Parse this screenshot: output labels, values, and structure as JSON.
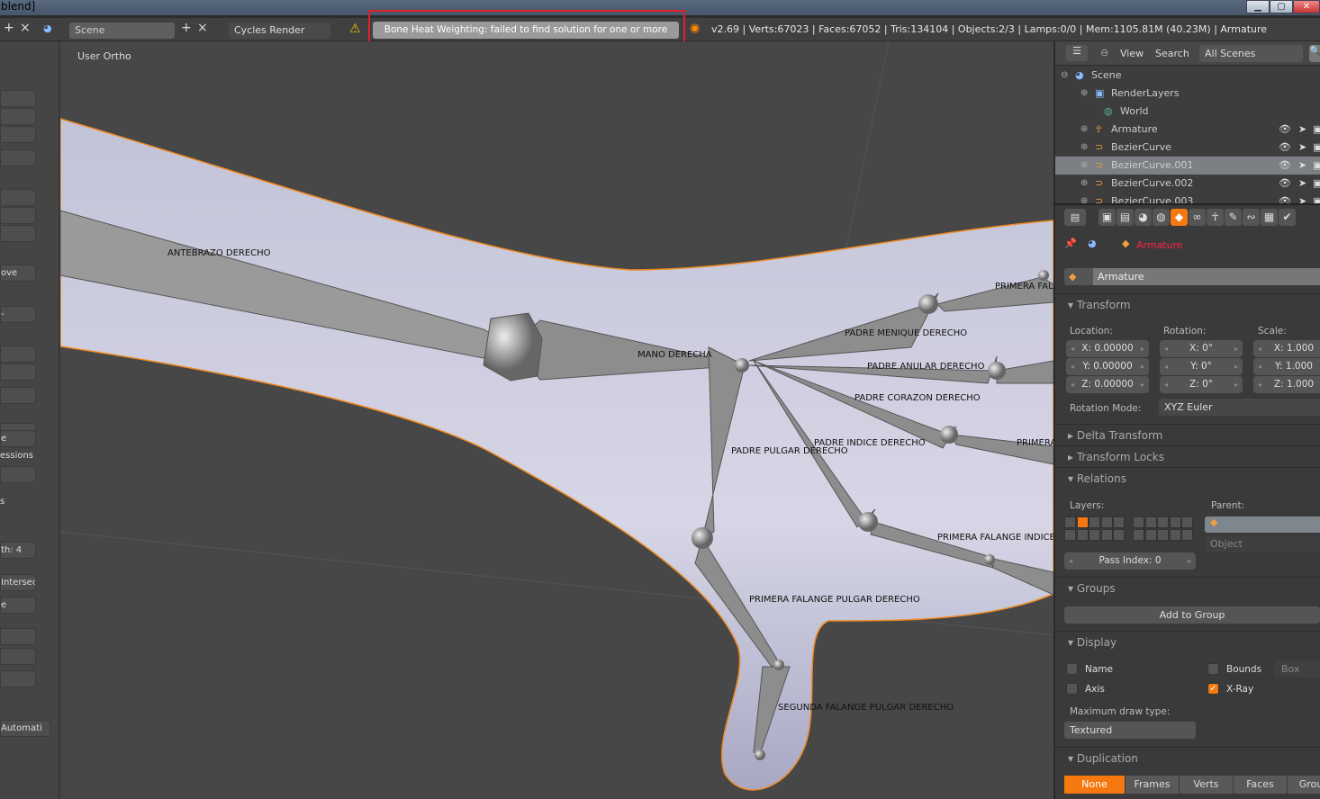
{
  "window": {
    "title": "blend]",
    "controls": [
      "minimize",
      "maximize",
      "close"
    ]
  },
  "header": {
    "add": "+",
    "remove": "×",
    "scene": "Scene",
    "engine": "Cycles Render",
    "warning_message": "Bone Heat Weighting: failed to find solution for one or more bones",
    "stats": "v2.69 | Verts:67023 | Faces:67052 | Tris:134104 | Objects:2/3 | Lamps:0/0 | Mem:1105.81M (40.23M) | Armature"
  },
  "shelf": {
    "items": [
      "",
      "",
      "",
      "",
      "",
      "",
      "",
      "ove",
      "-",
      "",
      "",
      "",
      "",
      "e",
      "essions",
      "",
      "s",
      "th: 4",
      "Intersec",
      "e",
      "",
      "",
      "",
      "Automati"
    ]
  },
  "viewport": {
    "view_name": "User Ortho",
    "bones": [
      "ANTEBRAZO DERECHO",
      "MANO DERECHA",
      "PADRE MENIQUE DERECHO",
      "PADRE ANULAR DERECHO",
      "PADRE CORAZON DERECHO",
      "PADRE INDICE DERECHO",
      "PADRE PULGAR DERECHO",
      "PRIMERA FALANGE INDICE",
      "PRIMERA FALANGE PULGAR DERECHO",
      "SEGUNDA FALANGE PULGAR DERECHO",
      "PRIMERA FAL",
      "PRIMERA"
    ],
    "colors": {
      "mesh": "#c9c9dd",
      "outline": "#f08a20",
      "bone": "#8d8d8d"
    }
  },
  "outliner": {
    "menu": [
      "View",
      "Search"
    ],
    "scope": "All Scenes",
    "items": [
      {
        "label": "Scene"
      },
      {
        "label": "RenderLayers"
      },
      {
        "label": "World"
      },
      {
        "label": "Armature"
      },
      {
        "label": "BezierCurve"
      },
      {
        "label": "BezierCurve.001",
        "selected": true
      },
      {
        "label": "BezierCurve.002"
      },
      {
        "label": "BezierCurve.003"
      }
    ]
  },
  "properties": {
    "context": "Armature",
    "object_name": "Armature",
    "transform": {
      "title": "Transform",
      "location_label": "Location:",
      "rotation_label": "Rotation:",
      "scale_label": "Scale:",
      "location": [
        "X: 0.00000",
        "Y: 0.00000",
        "Z: 0.00000"
      ],
      "rotation": [
        "X: 0°",
        "Y: 0°",
        "Z: 0°"
      ],
      "scale": [
        "X: 1.000",
        "Y: 1.000",
        "Z: 1.000"
      ],
      "rotation_mode_label": "Rotation Mode:",
      "rotation_mode": "XYZ Euler"
    },
    "delta_transform": "Delta Transform",
    "transform_locks": "Transform Locks",
    "relations": {
      "title": "Relations",
      "layers_label": "Layers:",
      "active_layer": 2,
      "parent_label": "Parent:",
      "parent_type": "Object",
      "pass_index": "Pass Index: 0"
    },
    "groups": {
      "title": "Groups",
      "add": "Add to Group"
    },
    "display": {
      "title": "Display",
      "name": "Name",
      "axis": "Axis",
      "bounds": "Bounds",
      "bounds_type": "Box",
      "xray": "X-Ray",
      "name_checked": false,
      "axis_checked": false,
      "bounds_checked": false,
      "xray_checked": true,
      "max_draw_label": "Maximum draw type:",
      "max_draw": "Textured"
    },
    "duplication": {
      "title": "Duplication",
      "options": [
        "None",
        "Frames",
        "Verts",
        "Faces",
        "Group"
      ],
      "selected": "None"
    },
    "accent": "#f57910"
  }
}
